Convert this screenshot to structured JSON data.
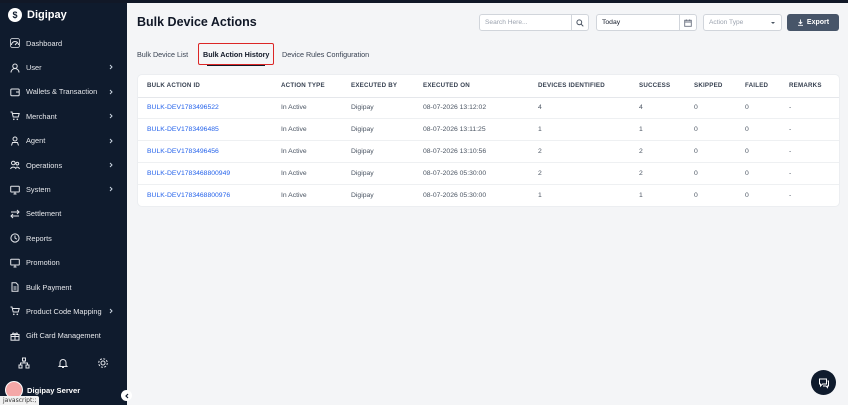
{
  "app": {
    "name": "Digipay"
  },
  "sidebar": {
    "items": [
      {
        "label": "Dashboard",
        "icon": "dashboard-icon",
        "chevron": false
      },
      {
        "label": "User",
        "icon": "user-icon",
        "chevron": true
      },
      {
        "label": "Wallets & Transaction",
        "icon": "wallet-icon",
        "chevron": true
      },
      {
        "label": "Merchant",
        "icon": "cart-icon",
        "chevron": true
      },
      {
        "label": "Agent",
        "icon": "agent-icon",
        "chevron": true
      },
      {
        "label": "Operations",
        "icon": "operations-icon",
        "chevron": true
      },
      {
        "label": "System",
        "icon": "monitor-icon",
        "chevron": true
      },
      {
        "label": "Settlement",
        "icon": "transfer-icon",
        "chevron": false
      },
      {
        "label": "Reports",
        "icon": "clock-icon",
        "chevron": false
      },
      {
        "label": "Promotion",
        "icon": "monitor-icon",
        "chevron": false
      },
      {
        "label": "Bulk Payment",
        "icon": "document-icon",
        "chevron": false
      },
      {
        "label": "Product Code Mapping",
        "icon": "cart-icon",
        "chevron": true
      },
      {
        "label": "Gift Card Management",
        "icon": "gift-icon",
        "chevron": false
      }
    ],
    "user_name": "Digipay Server"
  },
  "statusbar": "javascript:;",
  "header": {
    "title": "Bulk Device Actions",
    "search_placeholder": "Search Here...",
    "date_value": "Today",
    "action_type_placeholder": "Action Type",
    "export_label": "Export"
  },
  "tabs": [
    {
      "label": "Bulk Device List",
      "active": false
    },
    {
      "label": "Bulk Action History",
      "active": true
    },
    {
      "label": "Device Rules Configuration",
      "active": false
    }
  ],
  "table": {
    "columns": [
      "Bulk Action ID",
      "Action Type",
      "Executed By",
      "Executed On",
      "Devices Identified",
      "Success",
      "Skipped",
      "Failed",
      "Remarks"
    ],
    "rows": [
      [
        "BULK-DEV1783496522",
        "In Active",
        "Digipay",
        "08-07-2026 13:12:02",
        "4",
        "4",
        "0",
        "0",
        "-"
      ],
      [
        "BULK-DEV1783496485",
        "In Active",
        "Digipay",
        "08-07-2026 13:11:25",
        "1",
        "1",
        "0",
        "0",
        "-"
      ],
      [
        "BULK-DEV1783496456",
        "In Active",
        "Digipay",
        "08-07-2026 13:10:56",
        "2",
        "2",
        "0",
        "0",
        "-"
      ],
      [
        "BULK-DEV1783468800949",
        "In Active",
        "Digipay",
        "08-07-2026 05:30:00",
        "2",
        "2",
        "0",
        "0",
        "-"
      ],
      [
        "BULK-DEV1783468800976",
        "In Active",
        "Digipay",
        "08-07-2026 05:30:00",
        "1",
        "1",
        "0",
        "0",
        "-"
      ]
    ]
  },
  "colors": {
    "sidebar_bg": "#0f1b2d",
    "link": "#2563eb",
    "active_tab_border": "#dc2626",
    "export_bg": "#475569"
  }
}
